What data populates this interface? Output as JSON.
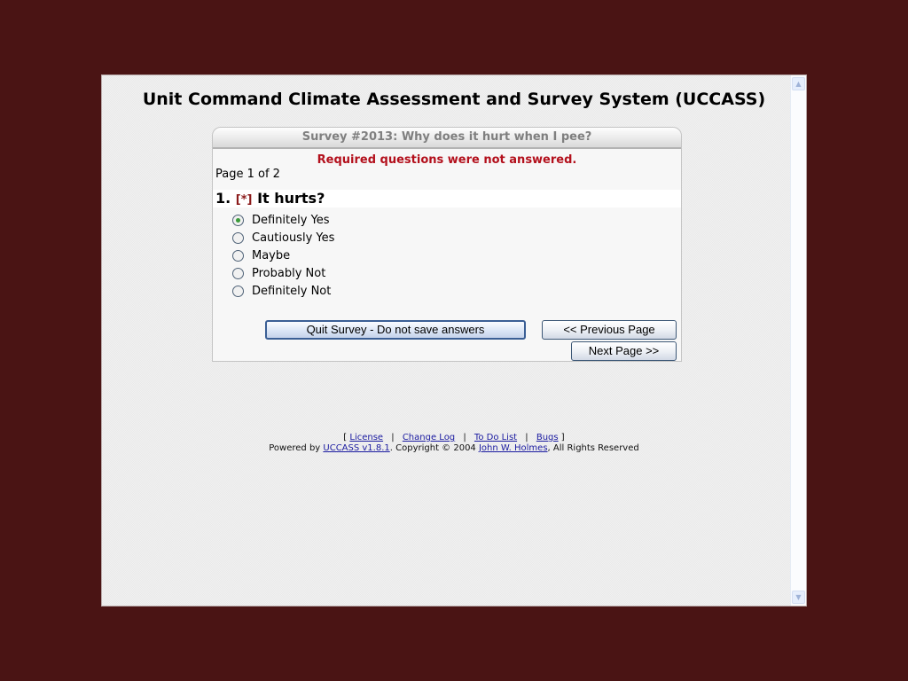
{
  "app": {
    "title": "Unit Command Climate Assessment and Survey System (UCCASS)"
  },
  "survey": {
    "header": "Survey #2013: Why does it hurt when I pee?",
    "error_message": "Required questions were not answered.",
    "page_indicator": "Page 1 of 2",
    "question": {
      "number": "1.",
      "required_mark": "[*]",
      "text": "It hurts?",
      "options": [
        {
          "label": "Definitely Yes",
          "selected": true
        },
        {
          "label": "Cautiously Yes",
          "selected": false
        },
        {
          "label": "Maybe",
          "selected": false
        },
        {
          "label": "Probably Not",
          "selected": false
        },
        {
          "label": "Definitely Not",
          "selected": false
        }
      ]
    },
    "buttons": {
      "quit": "Quit Survey - Do not save answers",
      "previous": "<< Previous Page",
      "next": "Next Page >>"
    }
  },
  "footer": {
    "open_bracket": "[",
    "close_bracket": "]",
    "separator": "|",
    "links": [
      "License",
      "Change Log",
      "To Do List",
      "Bugs"
    ],
    "powered_by": "Powered by ",
    "product_link": "UCCASS v1.8.1",
    "copyright": ". Copyright © 2004 ",
    "author_link": "John W. Holmes",
    "rights": ", All Rights Reserved"
  },
  "scrollbar": {
    "up_icon": "▲",
    "down_icon": "▼"
  }
}
